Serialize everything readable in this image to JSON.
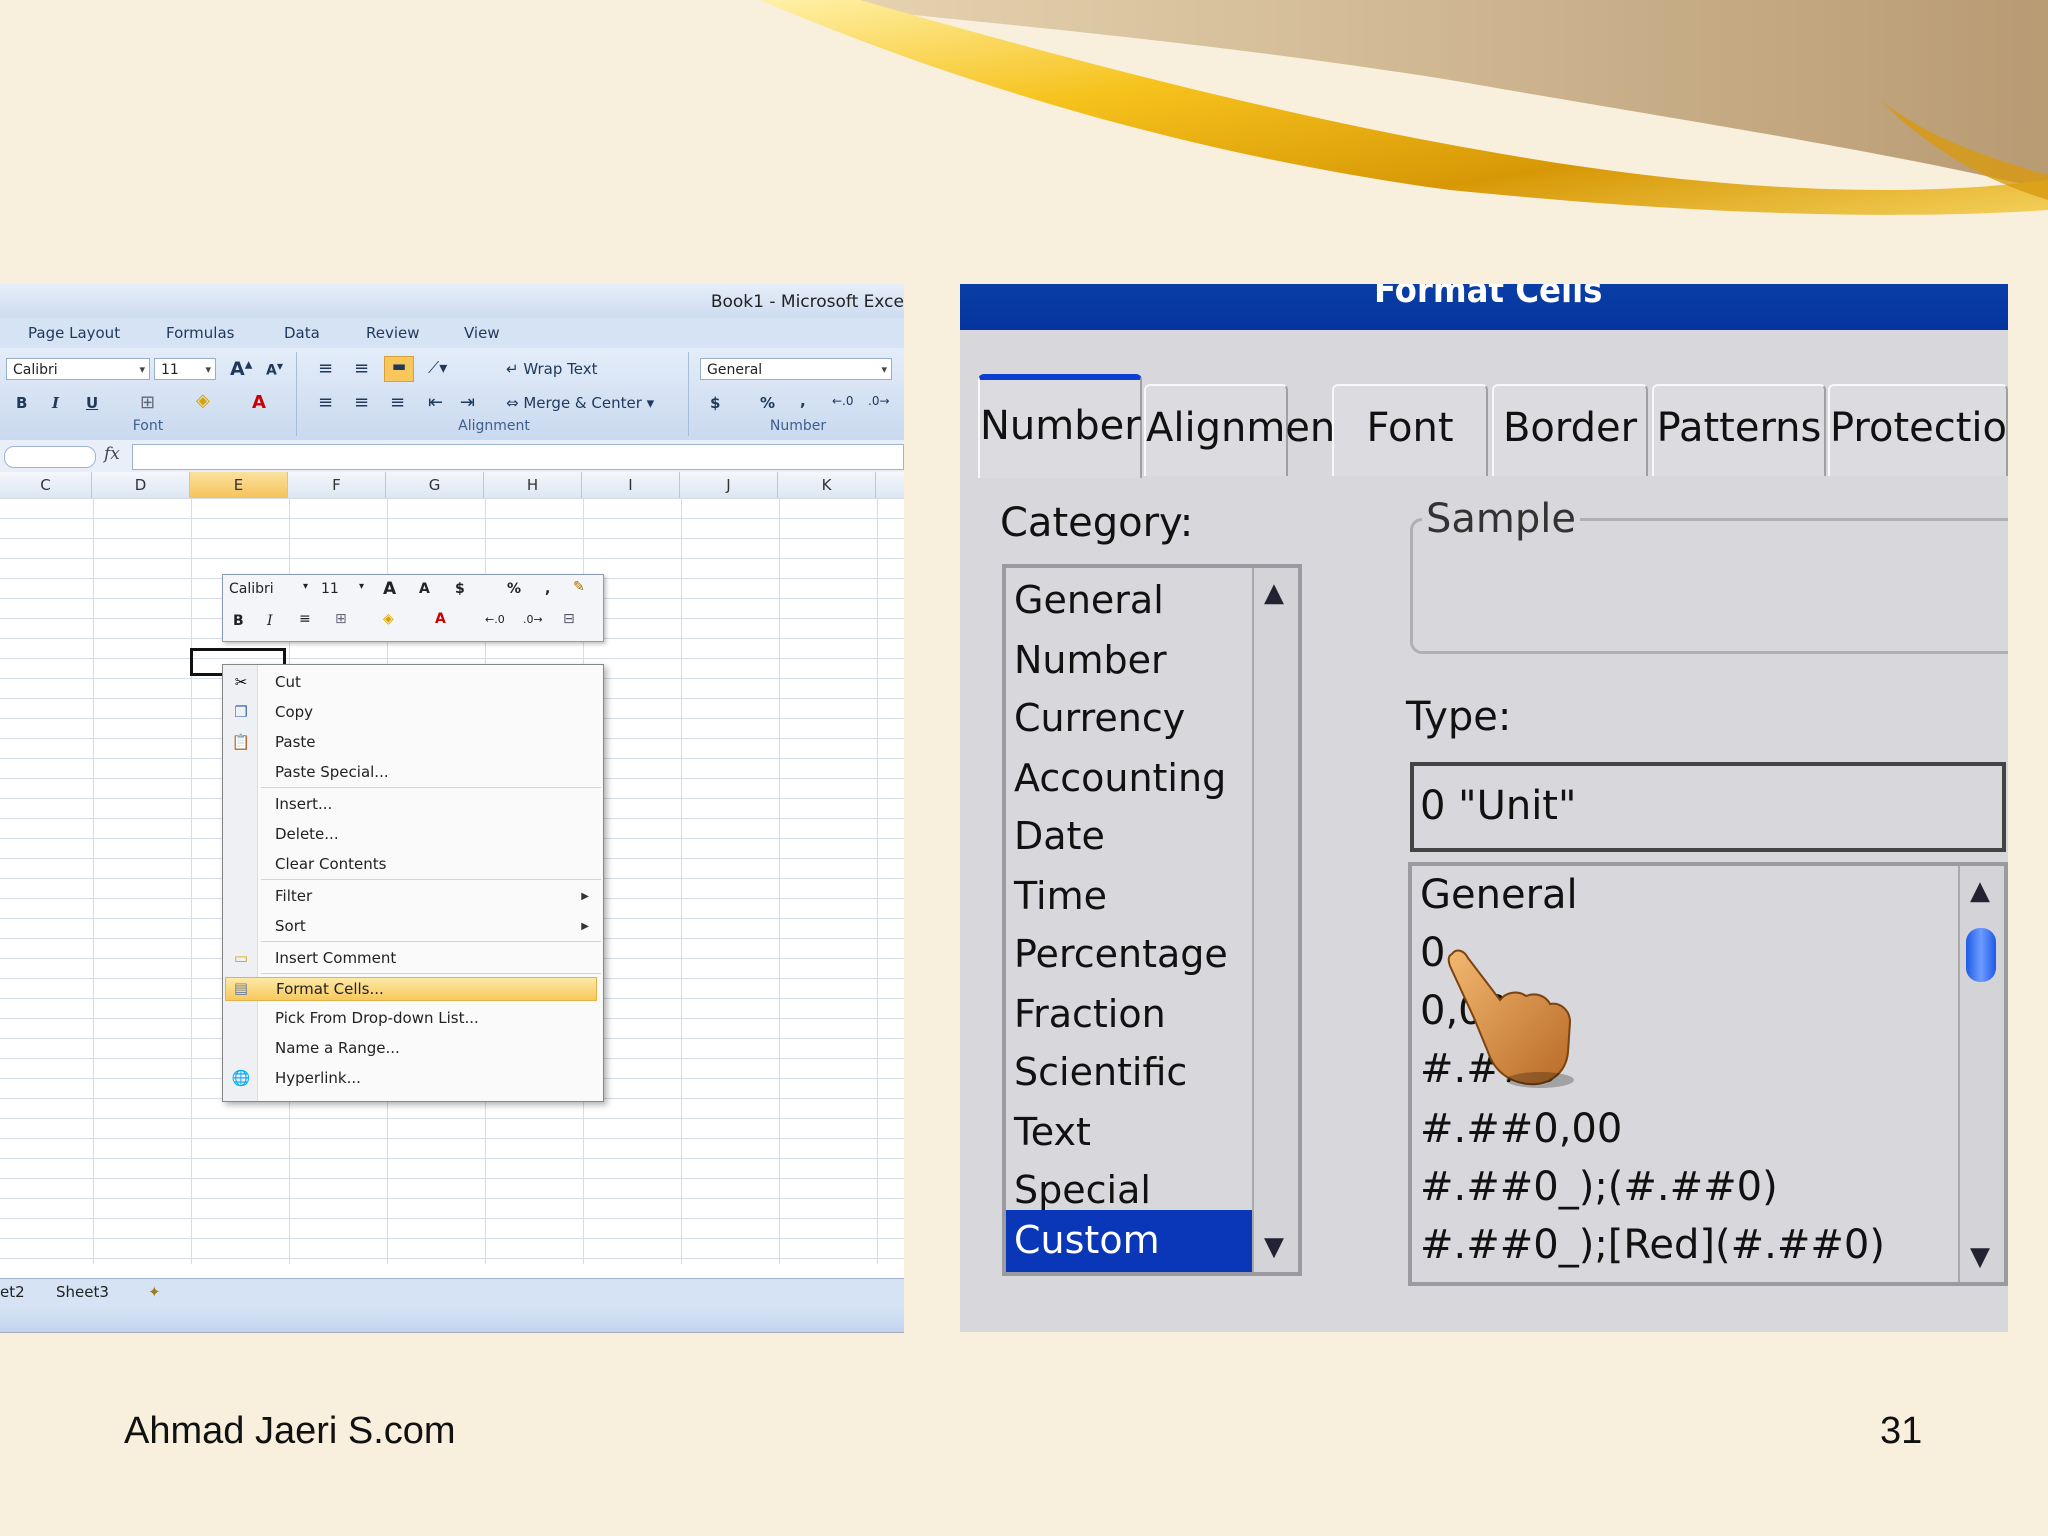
{
  "excel": {
    "window_title": "Book1 - Microsoft Exce",
    "ribbon_tabs": [
      "Page Layout",
      "Formulas",
      "Data",
      "Review",
      "View"
    ],
    "font_name": "Calibri",
    "font_size": "11",
    "wrap_text": "Wrap Text",
    "merge_center": "Merge & Center",
    "number_format": "General",
    "currency_symbol": "$",
    "percent_symbol": "%",
    "comma_symbol": ",",
    "group_font": "Font",
    "group_alignment": "Alignment",
    "group_number": "Number",
    "fx": "fx",
    "columns": [
      "C",
      "D",
      "E",
      "F",
      "G",
      "H",
      "I",
      "J",
      "K"
    ],
    "selected_column": "E",
    "sheet_tabs": [
      "et2",
      "Sheet3"
    ],
    "mini_toolbar": {
      "font": "Calibri",
      "size": "11",
      "currency": "$",
      "percent": "%",
      "comma": ","
    },
    "context_menu": [
      {
        "label": "Cut",
        "icon": "scissors-icon"
      },
      {
        "label": "Copy",
        "icon": "copy-icon"
      },
      {
        "label": "Paste",
        "icon": "paste-icon"
      },
      {
        "label": "Paste Special..."
      },
      {
        "label": "Insert..."
      },
      {
        "label": "Delete..."
      },
      {
        "label": "Clear Contents"
      },
      {
        "label": "Filter"
      },
      {
        "label": "Sort"
      },
      {
        "label": "Insert Comment",
        "icon": "comment-icon"
      },
      {
        "label": "Format Cells...",
        "icon": "format-cells-icon"
      },
      {
        "label": "Pick From Drop-down List..."
      },
      {
        "label": "Name a Range..."
      },
      {
        "label": "Hyperlink...",
        "icon": "globe-icon"
      }
    ]
  },
  "format_cells": {
    "title": "Format Cells",
    "tabs": [
      "Number",
      "Alignment",
      "Font",
      "Border",
      "Patterns",
      "Protection"
    ],
    "active_tab": "Number",
    "category_label": "Category:",
    "categories": [
      "General",
      "Number",
      "Currency",
      "Accounting",
      "Date",
      "Time",
      "Percentage",
      "Fraction",
      "Scientific",
      "Text",
      "Special",
      "Custom"
    ],
    "selected_category": "Custom",
    "sample_label": "Sample",
    "type_label": "Type:",
    "type_value": "0 \"Unit\"",
    "type_list": [
      "General",
      "0",
      "0,00",
      "#.##0",
      "#.##0,00",
      "#.##0_);(#.##0)",
      "#.##0_);[Red](#.##0)"
    ]
  },
  "footer": {
    "site": "Ahmad Jaeri S.com",
    "page_number": "31"
  },
  "colors": {
    "background": "#f8f0dc",
    "dialog_title": "#0a3ea6",
    "selection": "#0a36b8",
    "excel_highlight": "#f8c95c"
  }
}
